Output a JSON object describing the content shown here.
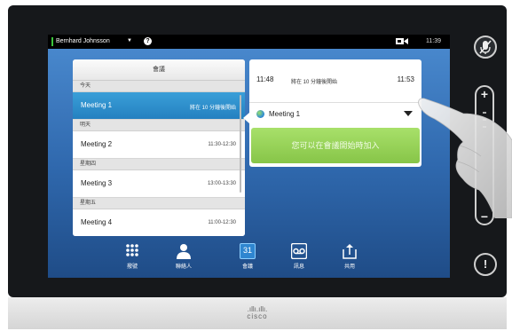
{
  "statusbar": {
    "user": "Bernhard Johnsson",
    "caret": "▼",
    "help": "?",
    "time": "11:39"
  },
  "meetings_panel": {
    "title": "會議",
    "sections": [
      {
        "label": "今天",
        "items": [
          {
            "name": "Meeting 1",
            "time": "將在 10 分鐘後開始",
            "selected": true
          }
        ]
      },
      {
        "label": "明天",
        "items": [
          {
            "name": "Meeting 2",
            "time": "11:30-12:30"
          }
        ]
      },
      {
        "label": "星期四",
        "items": [
          {
            "name": "Meeting 3",
            "time": "13:00-13:30"
          }
        ]
      },
      {
        "label": "星期五",
        "items": [
          {
            "name": "Meeting 4",
            "time": "11:00-12:30"
          }
        ]
      }
    ]
  },
  "detail": {
    "start": "11:48",
    "status": "將在 10 分鐘後開始",
    "end": "11:53",
    "meeting_name": "Meeting 1",
    "join_label": "您可以在會議開始時加入"
  },
  "bottombar": {
    "items": [
      {
        "label": "撥號",
        "icon": "keypad-icon"
      },
      {
        "label": "聯絡人",
        "icon": "person-icon"
      },
      {
        "label": "會議",
        "icon": "calendar-icon",
        "icon_text": "31"
      },
      {
        "label": "訊息",
        "icon": "voicemail-icon"
      },
      {
        "label": "共用",
        "icon": "share-icon"
      }
    ]
  },
  "side": {
    "alert": "!",
    "vol_plus": "+",
    "vol_minus": "−"
  },
  "brand": "cisco",
  "colors": {
    "selected_row": "#2c8ccb",
    "join_button": "#98d35a",
    "screen_bg": "#3d78c0"
  }
}
